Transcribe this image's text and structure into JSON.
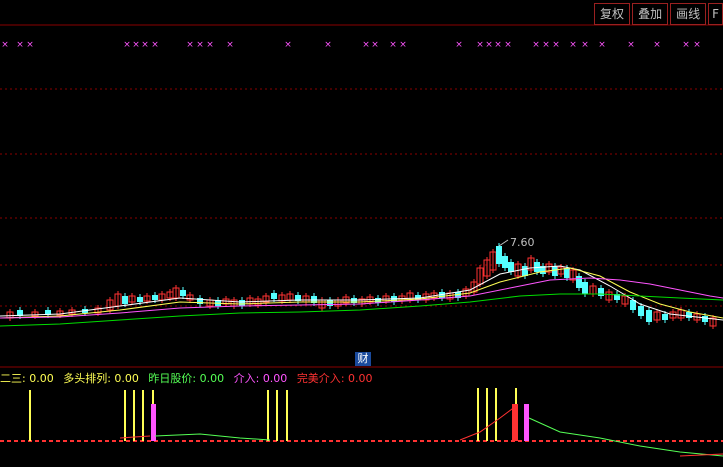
{
  "toolbar": {
    "buttons": [
      {
        "label": "复权"
      },
      {
        "label": "叠加"
      },
      {
        "label": "画线"
      },
      {
        "label": "F"
      }
    ]
  },
  "price_chart": {
    "high_marker": "7.60",
    "finance_badge": "财",
    "colors": {
      "up_candle": "#ff3232",
      "down_candle": "#54ffff",
      "ma_short": "#ffffff",
      "ma_mid": "#ffff55",
      "ma_long": "#ff55ff",
      "ma_longest": "#00dd00",
      "cross_marker": "#ff55ff",
      "grid": "#8a0000"
    }
  },
  "indicator": {
    "items": [
      {
        "name": "二三",
        "value": "0.00",
        "color": "#ffff55"
      },
      {
        "name": "多头排列",
        "value": "0.00",
        "color": "#ffff55"
      },
      {
        "name": "昨日股价",
        "value": "0.00",
        "color": "#55ff55"
      },
      {
        "name": "介入",
        "value": "0.00",
        "color": "#ff55ff"
      },
      {
        "name": "完美介入",
        "value": "0.00",
        "color": "#ff3232"
      }
    ]
  }
}
